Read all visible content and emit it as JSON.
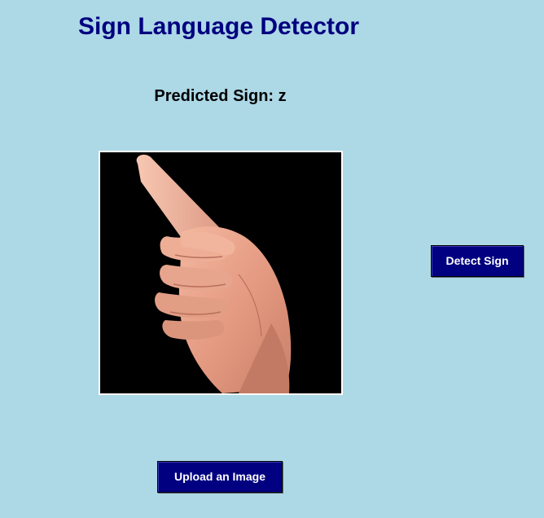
{
  "app": {
    "title": "Sign Language Detector"
  },
  "result": {
    "text": "Predicted Sign: z"
  },
  "preview": {
    "icon": "hand-pointing-up-image"
  },
  "buttons": {
    "detect_label": "Detect Sign",
    "upload_label": "Upload an Image"
  },
  "colors": {
    "background": "#add8e6",
    "title": "#000080",
    "button_bg": "#000080",
    "button_text": "#ffffff"
  }
}
